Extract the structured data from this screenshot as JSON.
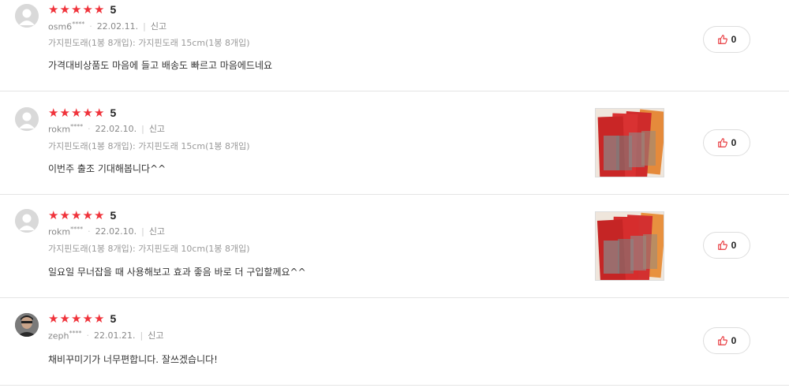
{
  "reviews": [
    {
      "rating": "5",
      "user": "osm6",
      "mask": "****",
      "date": "22.02.11.",
      "report": "신고",
      "option": "가지핀도래(1봉 8개입): 가지핀도래 15cm(1봉 8개입)",
      "content": "가격대비상품도 마음에 들고 배송도 빠르고 마음에드네요",
      "likes": "0",
      "has_photo": false
    },
    {
      "rating": "5",
      "user": "rokm",
      "mask": "****",
      "date": "22.02.10.",
      "report": "신고",
      "option": "가지핀도래(1봉 8개입): 가지핀도래 15cm(1봉 8개입)",
      "content": "이번주 출조 기대해봅니다^^",
      "likes": "0",
      "has_photo": true
    },
    {
      "rating": "5",
      "user": "rokm",
      "mask": "****",
      "date": "22.02.10.",
      "report": "신고",
      "option": "가지핀도래(1봉 8개입): 가지핀도래 10cm(1봉 8개입)",
      "content": "일요일 무너잡을 때 사용해보고 효과 좋음 바로 더 구입할께요^^",
      "likes": "0",
      "has_photo": true
    },
    {
      "rating": "5",
      "user": "zeph",
      "mask": "****",
      "date": "22.01.21.",
      "report": "신고",
      "option": "",
      "content": "채비꾸미기가 너무편합니다. 잘쓰겠습니다!",
      "likes": "0",
      "has_photo": false
    }
  ],
  "colors": {
    "star": "#f0333b",
    "like_icon": "#e8383d",
    "divider": "#e5e5e5"
  },
  "icons": {
    "star": "star-icon",
    "like": "thumbs-up-icon",
    "avatar_default": "default-avatar-icon",
    "avatar_photo": "user-photo-avatar"
  }
}
